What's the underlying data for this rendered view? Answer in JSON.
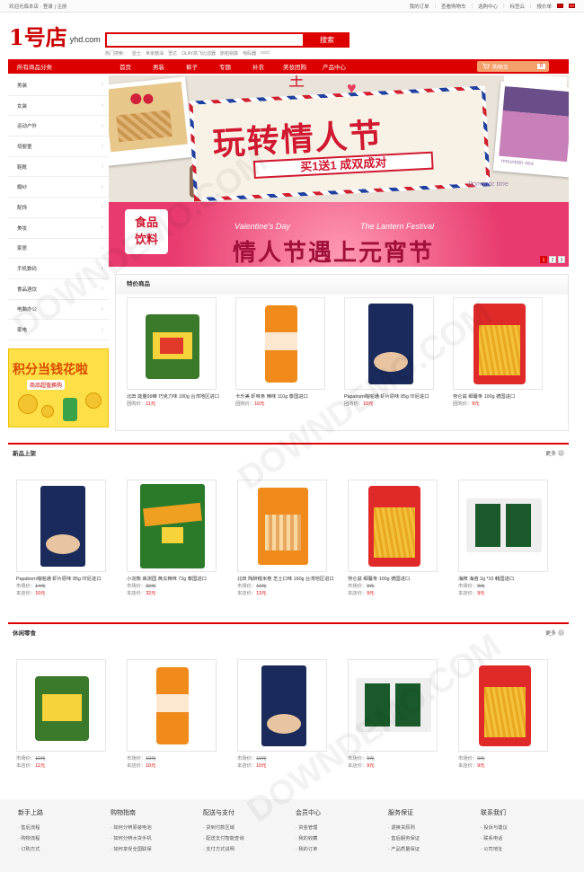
{
  "topbar": {
    "welcome": "欢迎光临本店 ·",
    "login": "登录",
    "sep": "|",
    "register": "注册",
    "links": [
      "我的订单",
      "查看购物车",
      "选购中心",
      "标签云",
      "报价单"
    ]
  },
  "logo": {
    "mark": "1号店",
    "text": "yhd.com"
  },
  "search": {
    "placeholder": "",
    "button": "搜索",
    "hot_label": "热门搜索：",
    "hot": [
      "蓝士",
      "世家酱油",
      "雪达",
      "OLAY高飞比滤器",
      "斯帕锅粪",
      "电码器",
      "cccc"
    ]
  },
  "nav": {
    "all": "所有商品分类",
    "items": [
      "首页",
      "男装",
      "裤子",
      "专题",
      "补衣",
      "美妆团购",
      "产品中心"
    ],
    "cart_label": "购物车",
    "cart_count": "0"
  },
  "sidebar": [
    "男装",
    "女装",
    "运动户外",
    "母婴童",
    "鞋靴",
    "婚纱",
    "配饰",
    "美妆",
    "家居",
    "手机数码",
    "食品酒饮",
    "电脑办公",
    "家电"
  ],
  "promo": {
    "title": "积分当钱花啦",
    "sub": "商品超值换购"
  },
  "banner1": {
    "main": "玩转情人节",
    "sub": "买1送1 成双成对",
    "top": "王",
    "brand": "mountain sea",
    "caption": "Romantic time"
  },
  "banner2": {
    "tag1": "食品",
    "tag2": "饮料",
    "en1": "Valentine's Day",
    "en2": "The Lantern Festival",
    "main": "情人节遇上元宵节"
  },
  "dots": [
    "1",
    "2",
    "3"
  ],
  "tejia": {
    "title": "特价商品",
    "items": [
      {
        "name": "北田 能量99棒 巧克力味 180g 台湾地区进口",
        "label": "团购价：",
        "price": "11元"
      },
      {
        "name": "卡乐美 虾味条 辣味 110g 泰国进口",
        "label": "团购价：",
        "price": "10元"
      },
      {
        "name": "Papaborn啪啪通 虾片原味 85g 印尼进口",
        "label": "团购价：",
        "price": "10元"
      },
      {
        "name": "劳仑兹 细薯条 100g 德国进口",
        "label": "团购价：",
        "price": "9元"
      }
    ]
  },
  "new": {
    "title": "新品上架",
    "more": "更多",
    "items": [
      {
        "name": "Papaborn啪啪通 虾片原味 85g 印尼进口",
        "market_label": "市场价：",
        "market": "14元",
        "store_label": "本店价：",
        "price": "10元"
      },
      {
        "name": "小浣熊 高测园 黄瓜辣味 72g 泰国进口",
        "market_label": "市场价：",
        "market": "32元",
        "store_label": "本店价：",
        "price": "32元"
      },
      {
        "name": "北田 陶醉糙米卷 芝士口味 160g 台湾地区进口",
        "market_label": "市场价：",
        "market": "12元",
        "store_label": "本店价：",
        "price": "13元"
      },
      {
        "name": "劳仑兹 细薯条 100g 德国进口",
        "market_label": "市场价：",
        "market": "9元",
        "store_label": "本店价：",
        "price": "9元"
      },
      {
        "name": "海牌 海苔 2g *10 韩国进口",
        "market_label": "市场价：",
        "market": "9元",
        "store_label": "本店价：",
        "price": "9元"
      }
    ]
  },
  "snack": {
    "title": "休闲零食",
    "more": "更多",
    "items": [
      {
        "market_label": "市场价：",
        "market": "10元",
        "store_label": "本店价：",
        "price": "11元"
      },
      {
        "market_label": "市场价：",
        "market": "10元",
        "store_label": "本店价：",
        "price": "10元"
      },
      {
        "market_label": "市场价：",
        "market": "10元",
        "store_label": "本店价：",
        "price": "10元"
      },
      {
        "market_label": "市场价：",
        "market": "9元",
        "store_label": "本店价：",
        "price": "9元"
      },
      {
        "market_label": "市场价：",
        "market": "9元",
        "store_label": "本店价：",
        "price": "9元"
      }
    ]
  },
  "footer": [
    {
      "title": "新手上路",
      "links": [
        "售后流程",
        "购物流程",
        "订购方式"
      ]
    },
    {
      "title": "购物指南",
      "links": [
        "如何分辨原装电池",
        "如何分辨水货手机",
        "如何享受全国联保"
      ]
    },
    {
      "title": "配送与支付",
      "links": [
        "货到付款区域",
        "配送支付智能查询",
        "支付方式说明"
      ]
    },
    {
      "title": "会员中心",
      "links": [
        "资金管理",
        "我的收藏",
        "我的订单"
      ]
    },
    {
      "title": "服务保证",
      "links": [
        "退换货原则",
        "售后服务保证",
        "产品质量保证"
      ]
    },
    {
      "title": "联系我们",
      "links": [
        "投诉与建议",
        "联系电话",
        "公司地址"
      ]
    }
  ],
  "watermark": "DOWNDEMO.COM"
}
